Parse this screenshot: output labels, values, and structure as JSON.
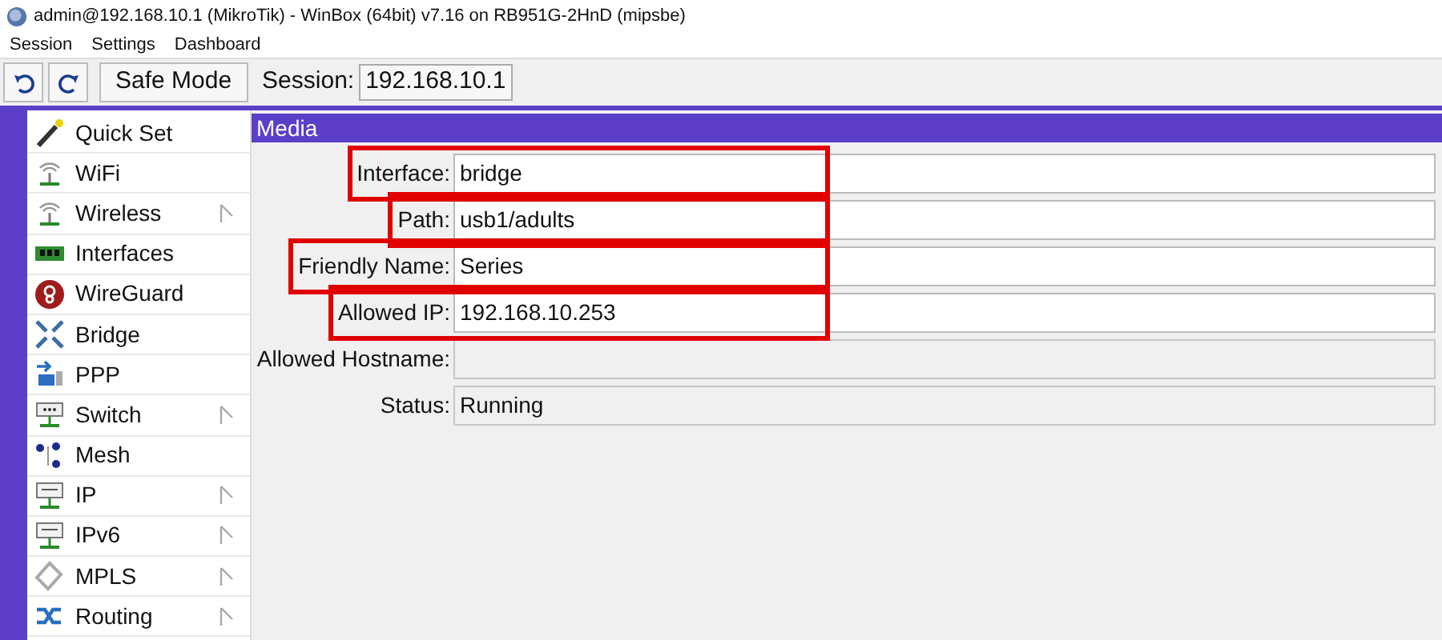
{
  "window": {
    "title": "admin@192.168.10.1 (MikroTik) - WinBox (64bit) v7.16 on RB951G-2HnD (mipsbe)"
  },
  "menu": [
    "Session",
    "Settings",
    "Dashboard"
  ],
  "toolbar": {
    "safe_mode": "Safe Mode",
    "session_label": "Session:",
    "session_value": "192.168.10.1"
  },
  "sidebar": {
    "items": [
      {
        "label": "Quick Set",
        "kind": "wand",
        "has_submenu": false
      },
      {
        "label": "WiFi",
        "kind": "antenna",
        "has_submenu": false
      },
      {
        "label": "Wireless",
        "kind": "antenna",
        "has_submenu": true
      },
      {
        "label": "Interfaces",
        "kind": "card",
        "has_submenu": false
      },
      {
        "label": "WireGuard",
        "kind": "dragon",
        "has_submenu": false
      },
      {
        "label": "Bridge",
        "kind": "arrows",
        "has_submenu": false
      },
      {
        "label": "PPP",
        "kind": "ppp",
        "has_submenu": false
      },
      {
        "label": "Switch",
        "kind": "switch",
        "has_submenu": true
      },
      {
        "label": "Mesh",
        "kind": "mesh",
        "has_submenu": false
      },
      {
        "label": "IP",
        "kind": "ip",
        "has_submenu": true
      },
      {
        "label": "IPv6",
        "kind": "ipv6",
        "has_submenu": true
      },
      {
        "label": "MPLS",
        "kind": "mpls",
        "has_submenu": true
      },
      {
        "label": "Routing",
        "kind": "routing",
        "has_submenu": true
      }
    ]
  },
  "form": {
    "title": "Media",
    "fields": [
      {
        "label": "Interface:",
        "value": "bridge",
        "highlighted": true,
        "disabled": false
      },
      {
        "label": "Path:",
        "value": "usb1/adults",
        "highlighted": true,
        "disabled": false
      },
      {
        "label": "Friendly Name:",
        "value": "Series",
        "highlighted": true,
        "disabled": false
      },
      {
        "label": "Allowed IP:",
        "value": "192.168.10.253",
        "highlighted": true,
        "disabled": false
      },
      {
        "label": "Allowed Hostname:",
        "disabled": true
      },
      {
        "label": "Status:",
        "value": "Running",
        "disabled": true
      }
    ]
  }
}
